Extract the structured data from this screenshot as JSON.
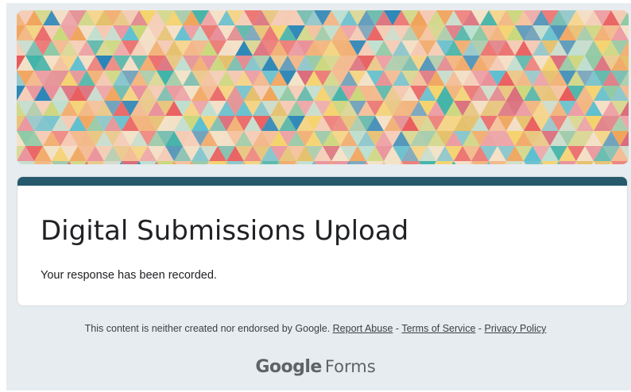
{
  "banner": {
    "colors": [
      "#e8585a",
      "#f0a35a",
      "#f4d36a",
      "#3fb3a8",
      "#2a86b8",
      "#8cc9a4",
      "#f4c9b3",
      "#e98f9b",
      "#c9d87a",
      "#f2e3c8",
      "#d96a7a",
      "#5bbfd0",
      "#f3b78a",
      "#b9e0d2",
      "#e4c06a"
    ]
  },
  "form": {
    "title": "Digital Submissions Upload",
    "message": "Your response has been recorded.",
    "accent_color": "#26596c"
  },
  "footer": {
    "notice": "This content is neither created nor endorsed by Google.",
    "report_abuse": "Report Abuse",
    "separator": "-",
    "terms": "Terms of Service",
    "privacy": "Privacy Policy"
  },
  "brand": {
    "google": "Google",
    "forms": "Forms"
  }
}
